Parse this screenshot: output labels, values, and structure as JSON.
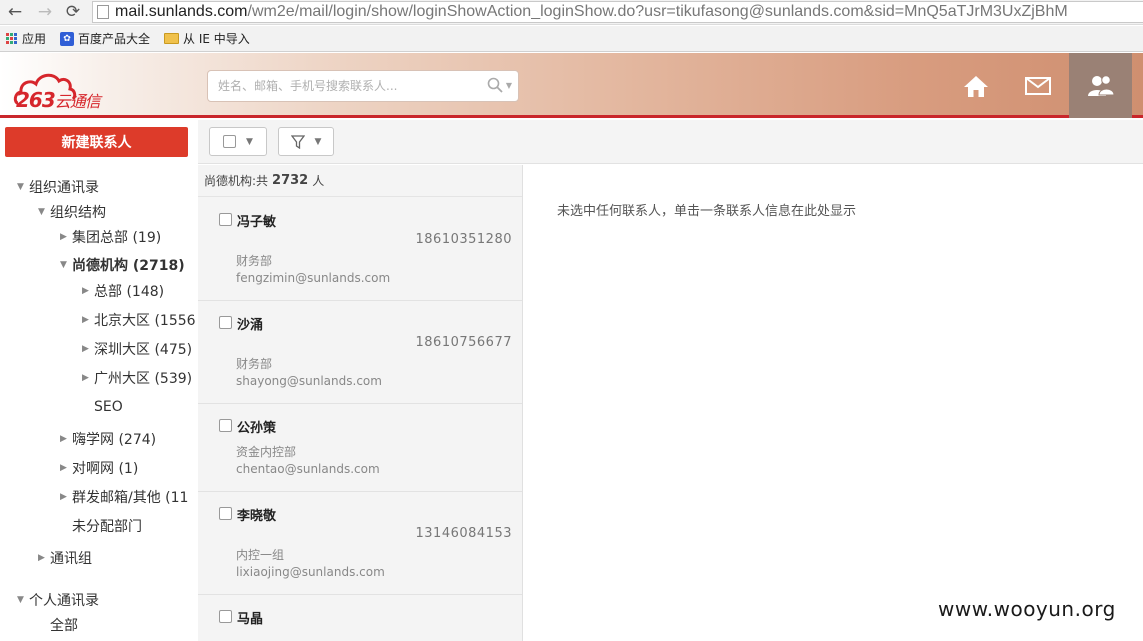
{
  "browser": {
    "url_host": "mail.sunlands.com",
    "url_path": "/wm2e/mail/login/show/loginShowAction_loginShow.do?usr=tikufasong@sunlands.com&sid=MnQ5aTJrM3UxZjBhM",
    "bookmarks": [
      "应用",
      "百度产品大全",
      "从 IE 中导入"
    ]
  },
  "header": {
    "logo_text": "263",
    "logo_sub": "云通信",
    "search_placeholder": "姓名、邮箱、手机号搜索联系人...",
    "icons": [
      "home-icon",
      "mail-icon",
      "contacts-icon"
    ]
  },
  "sidebar": {
    "new_contact": "新建联系人",
    "tree": [
      {
        "label": "组织通讯录",
        "arrow": "▼"
      },
      {
        "label": "组织结构",
        "arrow": "▼"
      },
      {
        "label": "集团总部 (19)",
        "arrow": "▶"
      },
      {
        "label": "尚德机构 (2718)",
        "arrow": "▼"
      },
      {
        "label": "总部 (148)",
        "arrow": "▶"
      },
      {
        "label": "北京大区 (1556",
        "arrow": "▶"
      },
      {
        "label": "深圳大区 (475)",
        "arrow": "▶"
      },
      {
        "label": "广州大区 (539)",
        "arrow": "▶"
      },
      {
        "label": "SEO",
        "arrow": ""
      },
      {
        "label": "嗨学网 (274)",
        "arrow": "▶"
      },
      {
        "label": "对啊网 (1)",
        "arrow": "▶"
      },
      {
        "label": "群发邮箱/其他 (11",
        "arrow": "▶"
      },
      {
        "label": "未分配部门",
        "arrow": ""
      },
      {
        "label": "通讯组",
        "arrow": "▶"
      },
      {
        "label": "个人通讯录",
        "arrow": "▼"
      },
      {
        "label": "全部",
        "arrow": ""
      }
    ]
  },
  "list": {
    "head_prefix": "尚德机构:共",
    "head_count": "2732",
    "head_unit": "人",
    "contacts": [
      {
        "name": "冯子敏",
        "phone": "18610351280",
        "dept": "财务部",
        "email": "fengzimin@sunlands.com"
      },
      {
        "name": "沙涌",
        "phone": "18610756677",
        "dept": "财务部",
        "email": "shayong@sunlands.com"
      },
      {
        "name": "公孙策",
        "phone": "",
        "dept": "资金内控部",
        "email": "chentao@sunlands.com"
      },
      {
        "name": "李晓敬",
        "phone": "13146084153",
        "dept": "内控一组",
        "email": "lixiaojing@sunlands.com"
      },
      {
        "name": "马晶",
        "phone": "",
        "dept": "",
        "email": ""
      }
    ]
  },
  "detail": {
    "empty_hint": "未选中任何联系人，单击一条联系人信息在此处显示"
  },
  "watermark": "www.wooyun.org"
}
